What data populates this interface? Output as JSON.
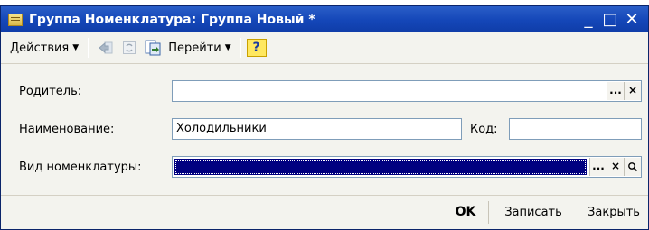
{
  "window": {
    "title": "Группа Номенклатура: Группа Новый *"
  },
  "title_controls": {
    "minimize": "_",
    "maximize": "□",
    "close": "✕"
  },
  "toolbar": {
    "actions_label": "Действия",
    "goto_label": "Перейти",
    "help_label": "?"
  },
  "form": {
    "parent_label": "Родитель:",
    "parent_value": "",
    "name_label": "Наименование:",
    "name_value": "Холодильники",
    "code_label": "Код:",
    "code_value": "",
    "type_label": "Вид номенклатуры:",
    "type_value": "",
    "select_button": "...",
    "clear_button": "×"
  },
  "buttons": {
    "ok": "OK",
    "save": "Записать",
    "close": "Закрыть"
  },
  "colors": {
    "titlebar": "#1446b8",
    "selection": "#000080",
    "window_bg": "#f3f3ee"
  }
}
